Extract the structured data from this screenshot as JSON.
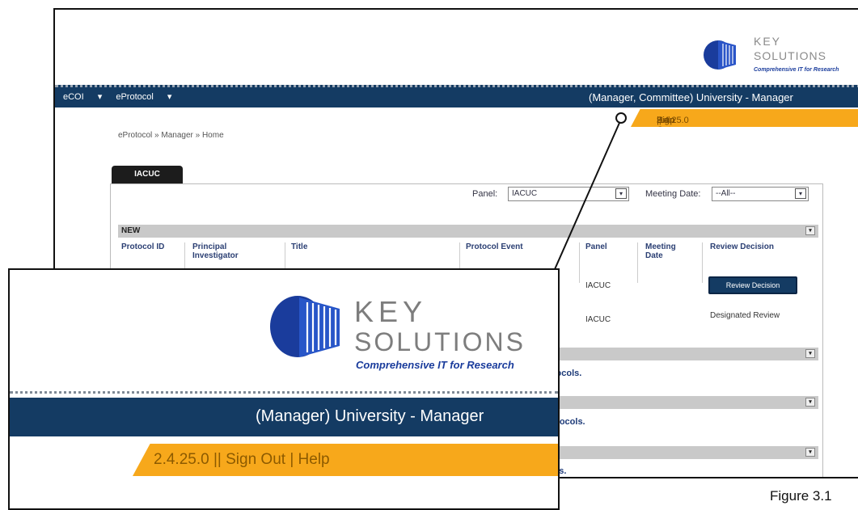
{
  "background": {
    "logo": {
      "word1": "KEY",
      "word2": "SOLUTIONS",
      "tagline": "Comprehensive IT for Research"
    },
    "nav": {
      "menus": [
        {
          "label": "eCOI"
        },
        {
          "label": "eProtocol"
        }
      ],
      "user_text": "(Manager, Committee) University - Manager"
    },
    "links_bar": {
      "version": "2.4.25.0",
      "separator": "||",
      "sign_out": "Sign Out",
      "pipe": "|",
      "help": "Help"
    },
    "breadcrumb": "eProtocol » Manager » Home",
    "tab_label": "IACUC",
    "filters": {
      "panel_label": "Panel:",
      "panel_value": "IACUC",
      "meeting_label": "Meeting Date:",
      "meeting_value": "--All--"
    },
    "new_section": {
      "title": "NEW",
      "columns": [
        "Protocol ID",
        "Principal Investigator",
        "Title",
        "Protocol Event",
        "Panel",
        "Meeting Date",
        "Review Decision"
      ],
      "rows": [
        {
          "panel": "IACUC",
          "decision_button": "Review Decision"
        },
        {
          "panel": "IACUC",
          "decision_text": "Designated Review"
        }
      ]
    },
    "section_messages": [
      "...otocols.",
      "...rotocols.",
      "...rms."
    ]
  },
  "zoom": {
    "logo": {
      "word1": "KEY",
      "word2": "SOLUTIONS",
      "tagline": "Comprehensive IT for Research"
    },
    "user_text": "(Manager) University - Manager",
    "links_bar": {
      "version": "2.4.25.0",
      "separator": "||",
      "sign_out": "Sign Out",
      "pipe": "|",
      "help": "Help"
    }
  },
  "caption": "Figure 3.1",
  "colors": {
    "navy": "#143b63",
    "orange": "#f7a81b",
    "logo_blue": "#1a3c9c",
    "link_blue": "#1d3a78"
  }
}
